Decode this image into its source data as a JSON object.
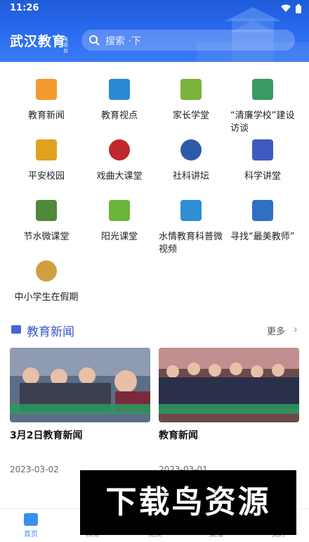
{
  "status_bar": {
    "time": "11:26"
  },
  "header": {
    "brand": "武汉教育",
    "brand_sub": "电视台",
    "search_placeholder": "搜索 ·下"
  },
  "grid": [
    {
      "label": "教育新闻",
      "icon": "education-news-icon",
      "color": "#f29b2f"
    },
    {
      "label": "教育视点",
      "icon": "education-viewpoint-icon",
      "color": "#2a8ad6"
    },
    {
      "label": "家长学堂",
      "icon": "parent-school-icon",
      "color": "#7ab43a"
    },
    {
      "label": "“清廉学校”建设访谈",
      "icon": "clean-school-icon",
      "color": "#3a9a62"
    },
    {
      "label": "平安校园",
      "icon": "safe-campus-icon",
      "color": "#e0a21f"
    },
    {
      "label": "戏曲大课堂",
      "icon": "opera-class-icon",
      "color": "#c0282b"
    },
    {
      "label": "社科讲坛",
      "icon": "social-science-forum-icon",
      "color": "#2d5aa8"
    },
    {
      "label": "科学讲堂",
      "icon": "science-lecture-icon",
      "color": "#3f5bc0"
    },
    {
      "label": "节水微课堂",
      "icon": "water-saving-class-icon",
      "color": "#4e8a3a"
    },
    {
      "label": "阳光课堂",
      "icon": "sunshine-class-icon",
      "color": "#6bb53a"
    },
    {
      "label": "水情教育科普微视频",
      "icon": "water-education-video-icon",
      "color": "#2e8fd4"
    },
    {
      "label": "寻找“最美教师”",
      "icon": "best-teacher-icon",
      "color": "#2f6fc4"
    },
    {
      "label": "中小学生在假期",
      "icon": "students-holiday-icon",
      "color": "#d0a040"
    }
  ],
  "news_section": {
    "title": "教育新闻",
    "more": "更多",
    "cards": [
      {
        "title": "3月2日教育新闻",
        "date": "2023-03-02"
      },
      {
        "title": "教育新闻",
        "date": "2023-03-01"
      }
    ]
  },
  "bottom_nav": [
    {
      "label": "首页",
      "active": true
    },
    {
      "label": "教育"
    },
    {
      "label": "视频"
    },
    {
      "label": "直播"
    },
    {
      "label": "我的"
    }
  ],
  "watermark": "下载鸟资源",
  "colors": {
    "header": "#2a6cf0",
    "accent": "#3553c9"
  }
}
